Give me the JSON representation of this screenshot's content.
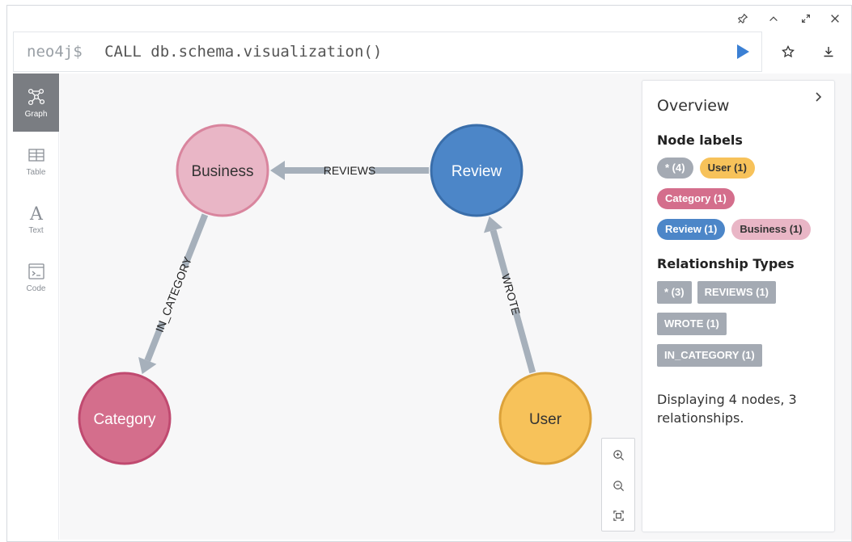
{
  "editor": {
    "prompt": "neo4j$",
    "query": "CALL db.schema.visualization()"
  },
  "window_controls": [
    "pin-icon",
    "collapse-icon",
    "expand-icon",
    "close-icon"
  ],
  "sidenav": {
    "items": [
      {
        "label": "Graph",
        "icon": "graph-icon",
        "active": true
      },
      {
        "label": "Table",
        "icon": "table-icon",
        "active": false
      },
      {
        "label": "Text",
        "icon": "text-icon",
        "active": false
      },
      {
        "label": "Code",
        "icon": "code-icon",
        "active": false
      }
    ]
  },
  "graph": {
    "nodes": [
      {
        "label": "Business",
        "fill": "#e9b6c6",
        "stroke": "#d9859e",
        "text_color": "#333333"
      },
      {
        "label": "Review",
        "fill": "#4c86c8",
        "stroke": "#3a6eaa",
        "text_color": "#ffffff"
      },
      {
        "label": "Category",
        "fill": "#d46e8c",
        "stroke": "#c04a70",
        "text_color": "#ffffff"
      },
      {
        "label": "User",
        "fill": "#f7c25a",
        "stroke": "#dca23a",
        "text_color": "#333333"
      }
    ],
    "relationships": [
      {
        "label": "REVIEWS",
        "from": "Review",
        "to": "Business"
      },
      {
        "label": "IN_CATEGORY",
        "from": "Business",
        "to": "Category"
      },
      {
        "label": "WROTE",
        "from": "User",
        "to": "Review"
      }
    ],
    "edge_color": "#a6b0bb"
  },
  "overview": {
    "title": "Overview",
    "node_labels_heading": "Node labels",
    "node_labels": [
      {
        "text": "* (4)",
        "bg": "#a4aab3",
        "color": "#ffffff"
      },
      {
        "text": "User (1)",
        "bg": "#f7c25a",
        "color": "#333333"
      },
      {
        "text": "Category (1)",
        "bg": "#d46e8c",
        "color": "#ffffff"
      },
      {
        "text": "Review (1)",
        "bg": "#4c86c8",
        "color": "#ffffff"
      },
      {
        "text": "Business (1)",
        "bg": "#e9b6c6",
        "color": "#333333"
      }
    ],
    "relationship_heading": "Relationship Types",
    "relationship_types": [
      "* (3)",
      "REVIEWS (1)",
      "WROTE (1)",
      "IN_CATEGORY (1)"
    ],
    "summary": "Displaying 4 nodes, 3 relationships."
  },
  "zoom_controls": [
    "zoom-in-icon",
    "zoom-out-icon",
    "fit-screen-icon"
  ]
}
